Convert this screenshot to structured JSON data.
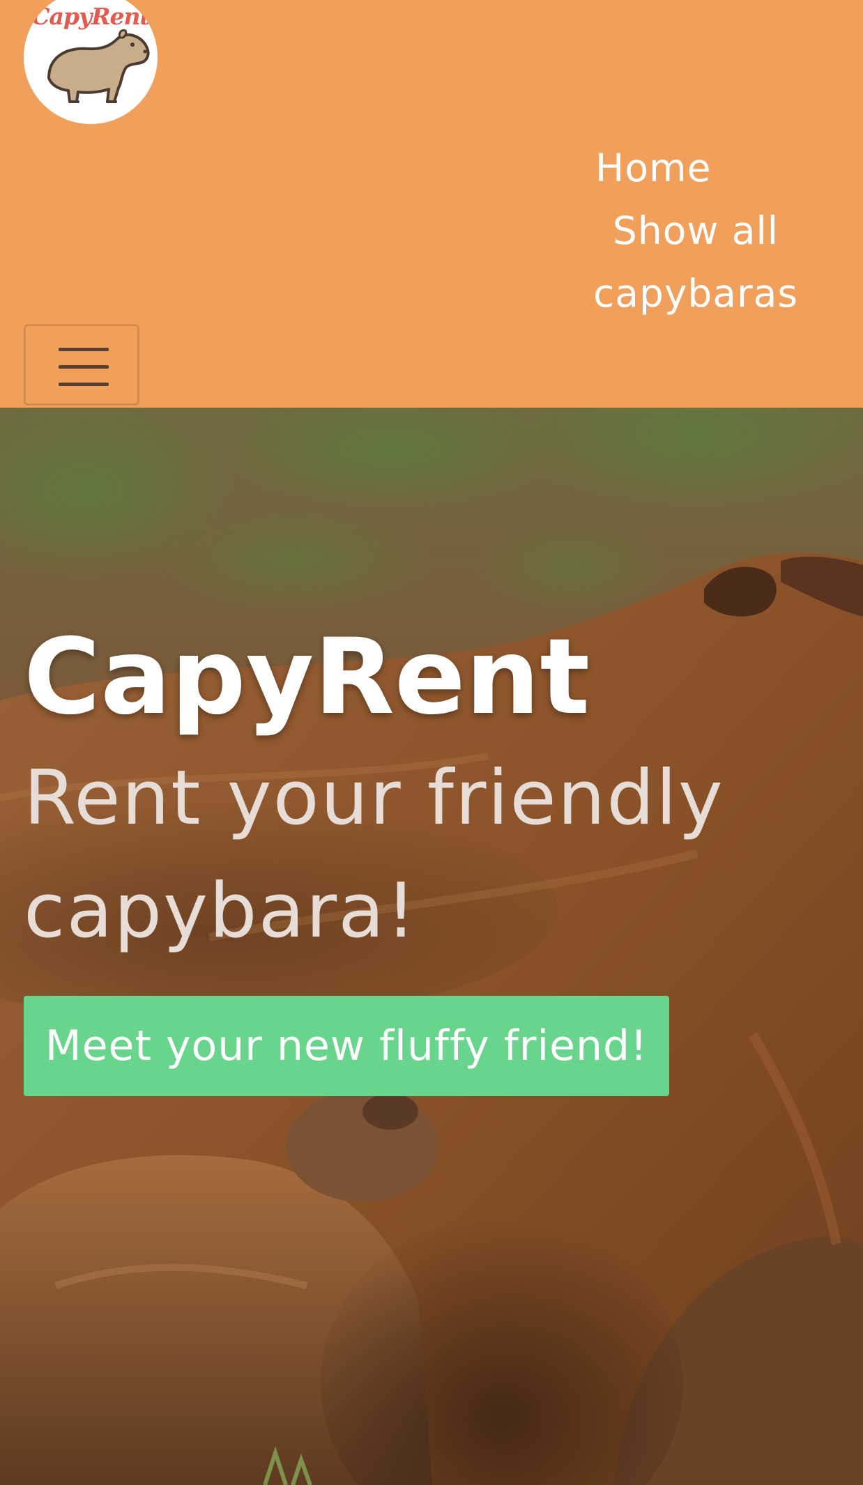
{
  "brand": {
    "logo_text": "CapyRent"
  },
  "nav": {
    "items": [
      {
        "label": "Home"
      },
      {
        "label": "Show all capybaras"
      }
    ]
  },
  "hero": {
    "title": "CapyRent",
    "subtitle": "Rent your friendly capybara!",
    "cta_label": "Meet your new fluffy friend!"
  },
  "colors": {
    "navbar_bg": "#f0a05a",
    "cta_bg": "#69d58c",
    "logo_text": "#e25b4e",
    "nav_text": "#ffffff"
  },
  "icons": {
    "logo": "capybara-icon",
    "menu": "hamburger-icon"
  }
}
